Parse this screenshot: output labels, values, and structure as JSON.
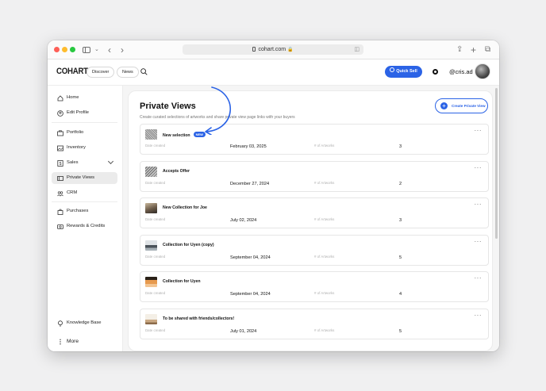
{
  "browser": {
    "url": "cohart.com"
  },
  "header": {
    "logo": "COHART",
    "discover_label": "Discover",
    "news_label": "News",
    "quick_sell_label": "Quick Sell",
    "username": "@cris.ad"
  },
  "sidebar": {
    "items": [
      {
        "label": "Home",
        "icon": "home-icon"
      },
      {
        "label": "Edit Profile",
        "icon": "user-icon"
      },
      {
        "label": "Portfolio",
        "icon": "portfolio-icon"
      },
      {
        "label": "Inventory",
        "icon": "image-icon"
      },
      {
        "label": "Sales",
        "icon": "dollar-icon"
      },
      {
        "label": "Private Views",
        "icon": "private-view-icon"
      },
      {
        "label": "CRM",
        "icon": "people-icon"
      },
      {
        "label": "Purchases",
        "icon": "bag-icon"
      },
      {
        "label": "Rewards & Credits",
        "icon": "reward-icon"
      },
      {
        "label": "Knowledge Base",
        "icon": "bulb-icon"
      },
      {
        "label": "More",
        "icon": "more-vertical-icon"
      }
    ],
    "active": "Private Views"
  },
  "main": {
    "title": "Private Views",
    "subtitle": "Create curated selections of artworks and share private view page links with your buyers",
    "create_label": "Create Private View",
    "date_label": "Date created",
    "count_label": "# of Artworks",
    "new_badge": "NEW",
    "rows": [
      {
        "name": "New selection",
        "date": "February 03, 2025",
        "count": "3",
        "is_new": true
      },
      {
        "name": "Accepts Offer",
        "date": "December 27, 2024",
        "count": "2",
        "is_new": false
      },
      {
        "name": "New Collection for Joe",
        "date": "July 02, 2024",
        "count": "3",
        "is_new": false
      },
      {
        "name": "Collection for Uyen (copy)",
        "date": "September 04, 2024",
        "count": "5",
        "is_new": false
      },
      {
        "name": "Collection for Uyen",
        "date": "September 04, 2024",
        "count": "4",
        "is_new": false
      },
      {
        "name": "To be shared with friends/collectors!",
        "date": "July 01, 2024",
        "count": "5",
        "is_new": false
      }
    ]
  },
  "colors": {
    "accent": "#2b63e6"
  }
}
